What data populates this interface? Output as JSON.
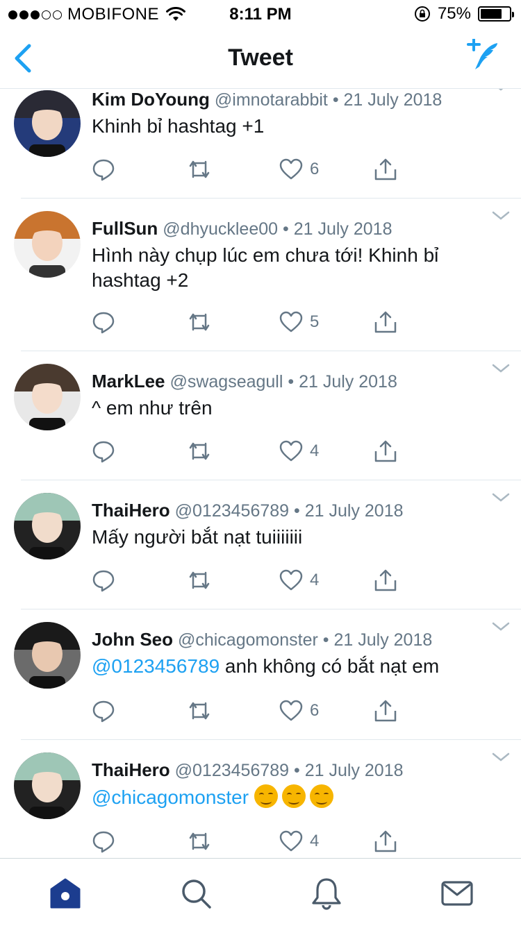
{
  "status_bar": {
    "carrier": "MOBIFONE",
    "time": "8:11 PM",
    "battery_percent": "75%",
    "battery_level": 0.75,
    "signal_bars_filled": 3,
    "signal_bars_total": 5
  },
  "nav": {
    "title": "Tweet",
    "back_icon": "chevron-left-icon",
    "compose_icon": "compose-tweet-icon",
    "accent": "#1da1f2"
  },
  "tweets": [
    {
      "name": "Kim DoYoung",
      "handle": "@imnotarabbit",
      "sep": "•",
      "date": "21 July 2018",
      "text": "Khinh bỉ hashtag +1",
      "likes": "6"
    },
    {
      "name": "FullSun",
      "handle": "@dhyucklee00",
      "sep": "•",
      "date": "21 July 2018",
      "text": "Hình này chụp lúc em chưa tới! Khinh bỉ hashtag +2",
      "likes": "5"
    },
    {
      "name": "MarkLee",
      "handle": "@swagseagull",
      "sep": "•",
      "date": "21 July 2018",
      "text": "^ em như trên",
      "likes": "4"
    },
    {
      "name": "ThaiHero",
      "handle": "@0123456789",
      "sep": "•",
      "date": "21 July 2018",
      "text": "Mấy người bắt nạt tuiiiiiii",
      "likes": "4"
    },
    {
      "name": "John Seo",
      "handle": "@chicagomonster",
      "sep": "•",
      "date": "21 July 2018",
      "mention": "@0123456789",
      "text": " anh không có bắt nạt em",
      "likes": "6"
    },
    {
      "name": "ThaiHero",
      "handle": "@0123456789",
      "sep": "•",
      "date": "21 July 2018",
      "mention": "@chicagomonster",
      "text": "",
      "emoji_count": 3,
      "likes": "4"
    }
  ],
  "tab_bar": {
    "items": [
      "home-icon",
      "search-icon",
      "notifications-icon",
      "messages-icon"
    ],
    "active": "home-icon",
    "active_color": "#1c3d8f",
    "inactive_color": "#4a5a6a"
  }
}
